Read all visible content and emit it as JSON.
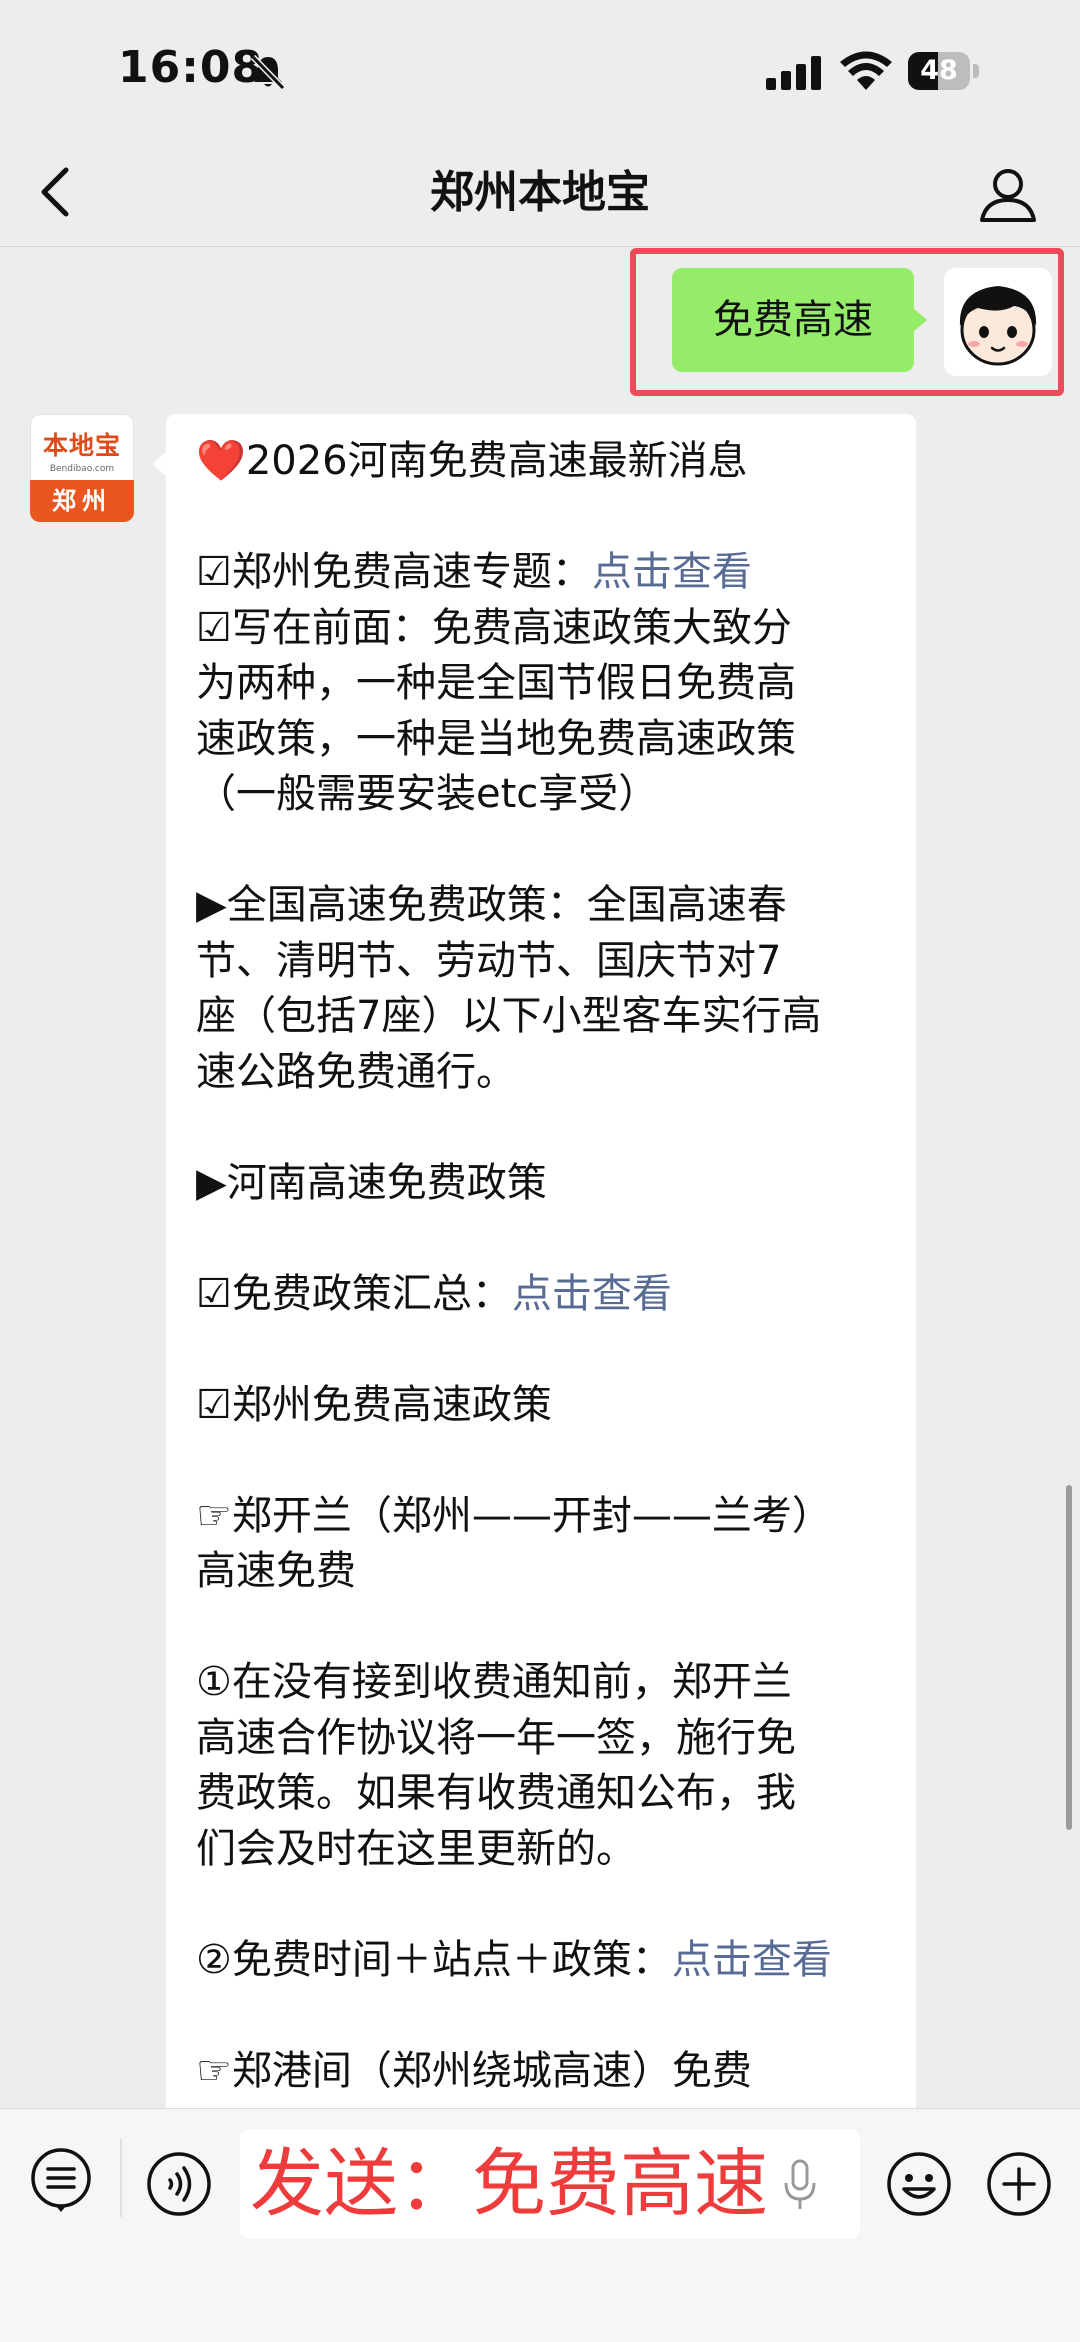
{
  "status_bar": {
    "time": "16:08",
    "battery_level": "48",
    "battery_fraction": 0.48
  },
  "nav": {
    "title": "郑州本地宝",
    "back_icon": "chevron-left-icon",
    "profile_icon": "person-icon"
  },
  "outgoing": {
    "text": "免费高速",
    "bubble_color": "#95ec69",
    "highlight_color": "#ef4a5a"
  },
  "sender_logo": {
    "name": "本地宝",
    "url": "Bendibao.com",
    "city": "郑州",
    "color": "#e9561e"
  },
  "message": {
    "lines": [
      [
        "❤️",
        "2026河南免费高速最新消息"
      ],
      [],
      [
        "☑郑州免费高速专题：",
        {
          "link": "点击查看"
        }
      ],
      [
        "☑写在前面：免费高速政策大致分"
      ],
      [
        "为两种，一种是全国节假日免费高"
      ],
      [
        "速政策，一种是当地免费高速政策"
      ],
      [
        "（一般需要安装etc享受）"
      ],
      [],
      [
        "▶全国高速免费政策：全国高速春"
      ],
      [
        "节、清明节、劳动节、国庆节对7"
      ],
      [
        "座（包括7座）以下小型客车实行高"
      ],
      [
        "速公路免费通行。"
      ],
      [],
      [
        "▶河南高速免费政策"
      ],
      [],
      [
        "☑免费政策汇总：",
        {
          "link": "点击查看"
        }
      ],
      [],
      [
        "☑郑州免费高速政策"
      ],
      [],
      [
        "☞郑开兰（郑州——开封——兰考）"
      ],
      [
        "高速免费"
      ],
      [],
      [
        "①在没有接到收费通知前，郑开兰"
      ],
      [
        "高速合作协议将一年一签，施行免"
      ],
      [
        "费政策。如果有收费通知公布，我"
      ],
      [
        "们会及时在这里更新的。"
      ],
      [],
      [
        "②免费时间＋站点＋政策：",
        {
          "link": "点击查看"
        }
      ],
      [],
      [
        "☞郑港间（郑州绕城高速）免费"
      ]
    ],
    "link_color": "#576b95"
  },
  "input_bar": {
    "text": "发送：免费高速",
    "text_color": "#ee3b3b",
    "icons": [
      "menu-list-icon",
      "voice-icon",
      "mic-icon",
      "emoji-icon",
      "plus-icon"
    ]
  }
}
